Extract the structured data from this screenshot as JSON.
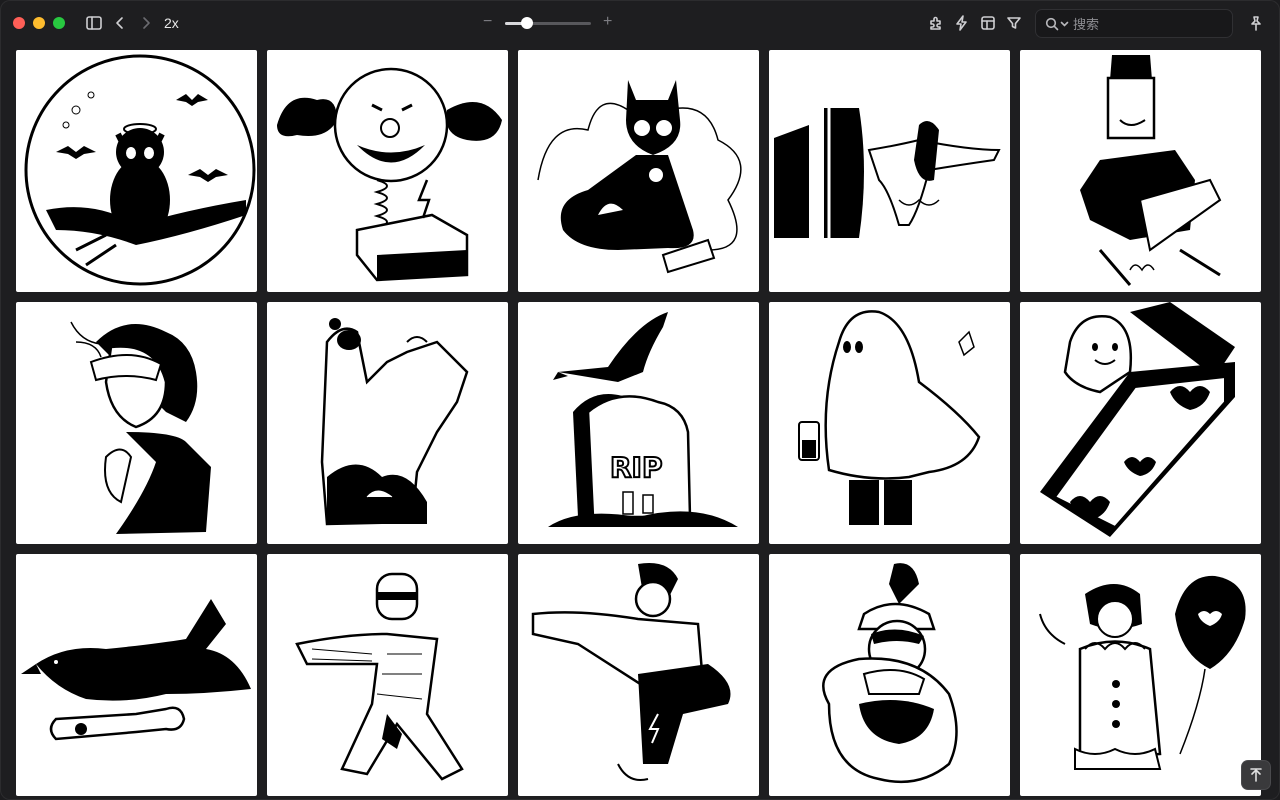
{
  "toolbar": {
    "zoom_label": "2x",
    "zoom_slider_value": 0.25,
    "search_placeholder": "搜索",
    "icons": [
      "sidebar-toggle-icon",
      "back-icon",
      "forward-icon",
      "zoom-out-icon",
      "zoom-in-icon",
      "extensions-icon",
      "bolt-icon",
      "layout-icon",
      "filter-icon",
      "search-icon",
      "pin-icon"
    ]
  },
  "gallery": {
    "items": [
      {
        "name": "owl-moon"
      },
      {
        "name": "clown-jack-in-the-box"
      },
      {
        "name": "skeleton-cat"
      },
      {
        "name": "ghost-through-door"
      },
      {
        "name": "frankenstein-walking"
      },
      {
        "name": "masked-woman"
      },
      {
        "name": "zombie-hand"
      },
      {
        "name": "crow-on-tombstone"
      },
      {
        "name": "sheet-ghost-lantern"
      },
      {
        "name": "ghost-in-coffin"
      },
      {
        "name": "crow-with-bone"
      },
      {
        "name": "mummy-walking"
      },
      {
        "name": "sleepwalker-zombie"
      },
      {
        "name": "witch-with-cauldron"
      },
      {
        "name": "clown-with-balloon"
      }
    ]
  },
  "scroll_top": {
    "icon": "arrow-up-icon"
  }
}
